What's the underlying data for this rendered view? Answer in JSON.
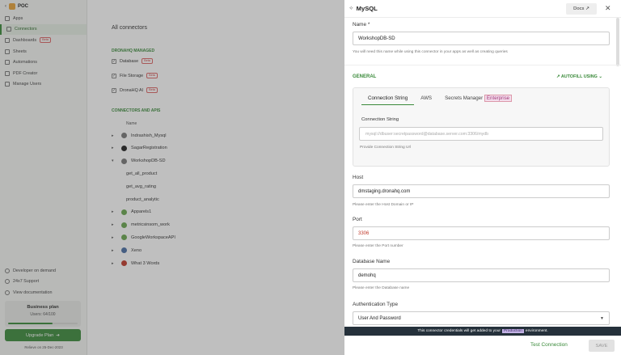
{
  "sidebar": {
    "workspace": "POC",
    "items": [
      {
        "label": "Apps",
        "icon": "apps-icon"
      },
      {
        "label": "Connectors",
        "icon": "plug-icon",
        "active": true
      },
      {
        "label": "Dashboards",
        "icon": "dashboard-icon",
        "badge": "Beta"
      },
      {
        "label": "Sheets",
        "icon": "sheet-icon"
      },
      {
        "label": "Automations",
        "icon": "automation-icon"
      },
      {
        "label": "PDF Creator",
        "icon": "pdf-icon"
      },
      {
        "label": "Manage Users",
        "icon": "users-icon"
      }
    ],
    "bottom_items": [
      {
        "label": "Developer on demand",
        "icon": "developer-icon"
      },
      {
        "label": "24x7 Support",
        "icon": "support-icon"
      },
      {
        "label": "View documentation",
        "icon": "docs-icon"
      }
    ],
    "plan": {
      "title": "Business plan",
      "users": "Users: 64/100",
      "usage": 0.64
    },
    "upgrade_label": "Upgrade Plan",
    "relieve_text": "Relieve on 25-Dec-2023"
  },
  "main": {
    "title": "All connectors",
    "managed_heading": "DRONAHQ MANAGED",
    "managed": [
      {
        "label": "Database",
        "badge": "Beta"
      },
      {
        "label": "File Storage",
        "badge": "Beta"
      },
      {
        "label": "DronaHQ AI",
        "badge": "Beta"
      }
    ],
    "apis_heading": "CONNECTORS AND APIS",
    "column": "Name",
    "rows": [
      {
        "label": "Indrashish_Mysql",
        "caret": "▸",
        "color": "#7a7a7a",
        "child": false
      },
      {
        "label": "SagarRegistration",
        "caret": "▸",
        "color": "#222222",
        "child": false
      },
      {
        "label": "WorkshopDB-SD",
        "caret": "▾",
        "color": "#7a7a7a",
        "child": false
      },
      {
        "label": "get_all_product",
        "caret": "",
        "color": "",
        "child": true
      },
      {
        "label": "get_avg_rating",
        "caret": "",
        "color": "",
        "child": true
      },
      {
        "label": "product_analytic",
        "caret": "",
        "color": "",
        "child": true
      },
      {
        "label": "Apparels1",
        "caret": "▸",
        "color": "#6aa84f",
        "child": false
      },
      {
        "label": "metricsinsom_work",
        "caret": "▸",
        "color": "#6aa84f",
        "child": false
      },
      {
        "label": "GoogleWorkspaceAPI",
        "caret": "▸",
        "color": "#6aa84f",
        "child": false
      },
      {
        "label": "Xeno",
        "caret": "▸",
        "color": "#4a6fa5",
        "child": false
      },
      {
        "label": "What 3 Words",
        "caret": "▸",
        "color": "#c0392b",
        "child": false
      }
    ]
  },
  "panel": {
    "title": "MySQL",
    "docs_label": "Docs ↗",
    "name_label": "Name *",
    "name_value": "WorkshopDB-SD",
    "name_hint": "You will need this name while using this connector in your apps as well as creating queries",
    "general_label": "GENERAL",
    "autofill_label": "↗ AUTOFILL USING ⌄",
    "tabs": [
      "Connection String",
      "AWS",
      "Secrets Manager"
    ],
    "enterprise_badge": "Enterprise",
    "conn_label": "Connection String",
    "conn_placeholder": "mysql://dbuser:secretpassword@database.server.com:3306/mydb",
    "conn_hint": "Provide Connection String Url",
    "host_label": "Host",
    "host_value": "dmstaging.dronahq.com",
    "host_hint": "Please enter the Host Domain or IP",
    "port_label": "Port",
    "port_value": "3306",
    "port_hint": "Please enter the Port number",
    "db_label": "Database Name",
    "db_value": "demohq",
    "db_hint": "Please enter the Database name",
    "auth_label": "Authentication Type",
    "auth_value": "User And Password",
    "banner_pre": "This connector credentials will get added to your",
    "banner_env": "Production",
    "banner_post": "environment.",
    "test_label": "Test Connection",
    "save_label": "SAVE",
    "port_color": "#c0392b"
  }
}
